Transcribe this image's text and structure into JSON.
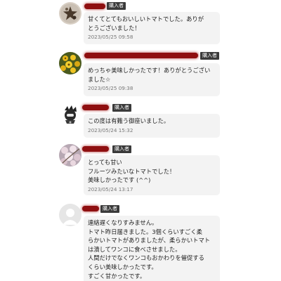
{
  "badge_label": "購入者",
  "reviews": [
    {
      "avatar": "star-ornament-avatar",
      "lines": [
        "甘くてとてもおいしいトマトでした。ありが",
        "とうございました！"
      ],
      "timestamp": "2023/05/25 09:58"
    },
    {
      "avatar": "yellow-flowers-avatar",
      "lines": [
        "めっちゃ美味しかったです！ありがとうござい",
        "ました☆"
      ],
      "timestamp": "2023/05/25 09:38"
    },
    {
      "avatar": "dark-character-avatar",
      "lines": [
        "この度は有難う御座いました。"
      ],
      "timestamp": "2023/05/24 15:32"
    },
    {
      "avatar": "pink-blossom-avatar",
      "lines": [
        "とっても甘い",
        "フルーツみたいなトマトでした！",
        "美味しかったです (^^)"
      ],
      "timestamp": "2023/05/24 13:17"
    },
    {
      "avatar": "default-user-avatar",
      "lines": [
        "連絡遅くなりすみません。",
        "トマト昨日届きました。3個くらいすごく柔",
        "らかいトマトがありましたが、柔らかいトマト",
        "は潰してワンコに食べさせました。",
        "人間だけでなくワンコもおかわりを催促する",
        "くらい美味しかったです。",
        "すごく甘かったです。"
      ],
      "timestamp": ""
    }
  ]
}
